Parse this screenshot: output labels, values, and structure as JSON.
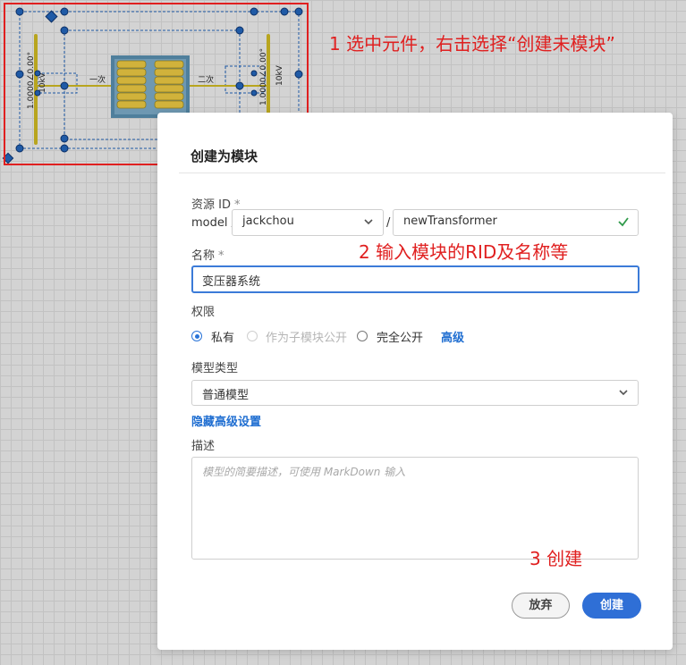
{
  "canvas": {
    "labels": {
      "voltage_left": "1.0000∠0.00°",
      "voltage_right": "1.0000∠0.00°",
      "kv_left": "10kV",
      "kv_right": "10kV",
      "primary": "一次",
      "secondary": "二次"
    }
  },
  "annotations": {
    "step1": "1 选中元件，右击选择“创建未模块”",
    "step2": "2 输入模块的RID及名称等",
    "step3": "3 创建"
  },
  "dialog": {
    "title": "创建为模块",
    "resource_id": {
      "label": "资源 ID",
      "required_mark": "*",
      "prefix": "model /",
      "owner": "jackchou",
      "separator": "/",
      "name": "newTransformer"
    },
    "name_field": {
      "label": "名称",
      "required_mark": "*",
      "value": "变压器系统"
    },
    "permission": {
      "label": "权限",
      "options": [
        {
          "label": "私有",
          "state": "selected"
        },
        {
          "label": "作为子模块公开",
          "state": "disabled"
        },
        {
          "label": "完全公开",
          "state": "unselected"
        }
      ],
      "advanced_link": "高级"
    },
    "model_type": {
      "label": "模型类型",
      "value": "普通模型"
    },
    "hide_advanced_link": "隐藏高级设置",
    "description": {
      "label": "描述",
      "placeholder": "模型的简要描述，可使用 MarkDown 输入"
    },
    "buttons": {
      "cancel": "放弃",
      "create": "创建"
    }
  },
  "colors": {
    "annotation": "#e02020",
    "accent": "#2f6fd6",
    "bus": "#b8a51f",
    "node": "#1f5aa6"
  }
}
